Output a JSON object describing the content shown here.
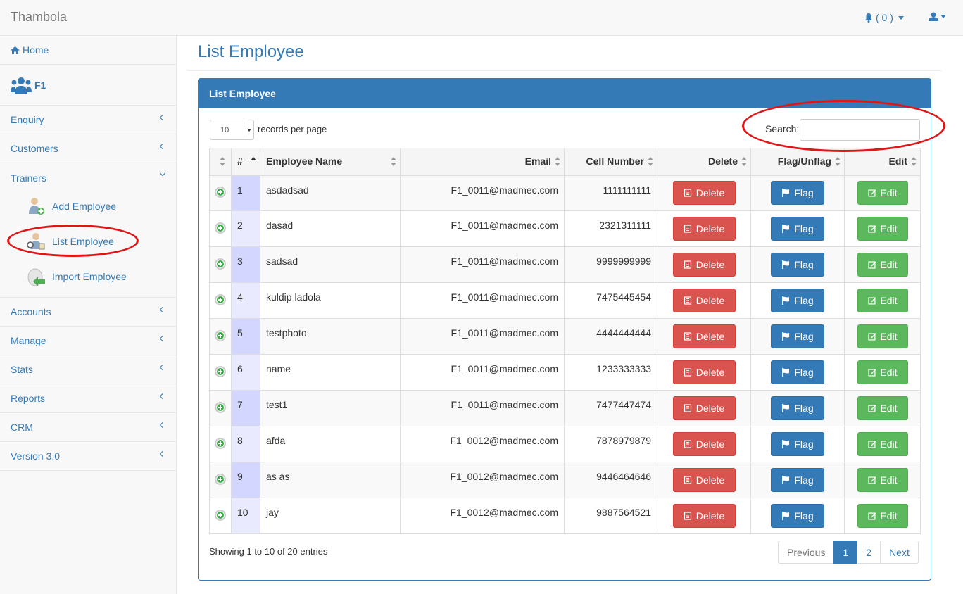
{
  "app": {
    "brand": "Thambola"
  },
  "header": {
    "notification_count": "( 0 )"
  },
  "sidebar": {
    "home": "Home",
    "profile": "F1",
    "items_top": [
      {
        "label": "Enquiry"
      },
      {
        "label": "Customers"
      },
      {
        "label": "Trainers"
      }
    ],
    "trainers_sub": [
      {
        "label": "Add Employee"
      },
      {
        "label": "List Employee"
      },
      {
        "label": "Import Employee"
      }
    ],
    "items_bottom": [
      {
        "label": "Accounts"
      },
      {
        "label": "Manage"
      },
      {
        "label": "Stats"
      },
      {
        "label": "Reports"
      },
      {
        "label": "CRM"
      },
      {
        "label": "Version 3.0"
      }
    ]
  },
  "main": {
    "page_title": "List Employee",
    "panel_title": "List Employee",
    "length_value": "10",
    "length_label": "records per page",
    "search_label": "Search:",
    "search_value": "",
    "columns": [
      "#",
      "Employee Name",
      "Email",
      "Cell Number",
      "Delete",
      "Flag/Unflag",
      "Edit"
    ],
    "rows": [
      {
        "n": "1",
        "name": "asdadsad",
        "email": "F1_0011@madmec.com",
        "cell": "1111111111"
      },
      {
        "n": "2",
        "name": "dasad",
        "email": "F1_0011@madmec.com",
        "cell": "2321311111"
      },
      {
        "n": "3",
        "name": "sadsad",
        "email": "F1_0011@madmec.com",
        "cell": "9999999999"
      },
      {
        "n": "4",
        "name": "kuldip ladola",
        "email": "F1_0011@madmec.com",
        "cell": "7475445454"
      },
      {
        "n": "5",
        "name": "testphoto",
        "email": "F1_0011@madmec.com",
        "cell": "4444444444"
      },
      {
        "n": "6",
        "name": "name",
        "email": "F1_0011@madmec.com",
        "cell": "1233333333"
      },
      {
        "n": "7",
        "name": "test1",
        "email": "F1_0011@madmec.com",
        "cell": "7477447474"
      },
      {
        "n": "8",
        "name": "afda",
        "email": "F1_0012@madmec.com",
        "cell": "7878979879"
      },
      {
        "n": "9",
        "name": "as as",
        "email": "F1_0012@madmec.com",
        "cell": "9446464646"
      },
      {
        "n": "10",
        "name": "jay",
        "email": "F1_0012@madmec.com",
        "cell": "9887564521"
      }
    ],
    "buttons": {
      "delete": "Delete",
      "flag": "Flag",
      "edit": "Edit"
    },
    "info": "Showing 1 to 10 of 20 entries",
    "pagination": {
      "previous": "Previous",
      "pages": [
        "1",
        "2"
      ],
      "next": "Next",
      "active": "1"
    }
  },
  "colors": {
    "primary": "#337ab7",
    "danger": "#d9534f",
    "success": "#5cb85c",
    "annotation": "#e01515"
  }
}
